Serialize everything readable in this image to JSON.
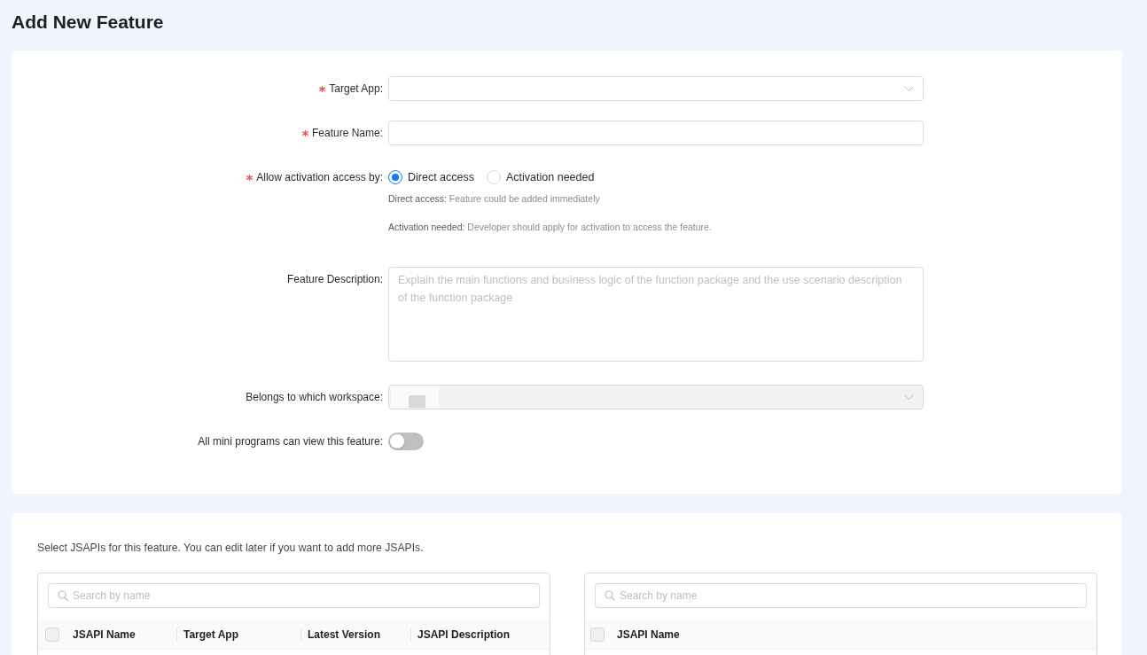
{
  "page": {
    "title": "Add New Feature"
  },
  "form": {
    "fields": [
      {
        "kind": "select",
        "label": "Target App:",
        "required": true,
        "disabled": false
      },
      {
        "kind": "input",
        "label": "Feature Name:",
        "required": true,
        "disabled": false
      },
      {
        "kind": "radio",
        "label": "Allow activation access by:",
        "required": true,
        "disabled": false,
        "options": [
          {
            "label": "Direct access",
            "selected": true
          },
          {
            "label": "Activation needed",
            "selected": false
          }
        ],
        "hints": [
          {
            "term": "Direct access:",
            "text": "Feature could be added immediately"
          },
          {
            "term": "Activation needed:",
            "text": "Developer should apply for activation to access the feature."
          }
        ]
      },
      {
        "kind": "textarea",
        "label": "Feature Description:",
        "required": false,
        "disabled": false,
        "placeholder": "Explain the main functions and business logic of the function package and the use scenario description of the function package"
      },
      {
        "kind": "select",
        "label": "Belongs to which workspace:",
        "required": false,
        "disabled": true,
        "masked_value": true
      },
      {
        "kind": "switch",
        "label": "All mini programs can view this feature:",
        "required": false,
        "disabled": false,
        "on": false
      }
    ]
  },
  "jsapi_section": {
    "instruction": "Select JSAPIs for this feature. You can edit later if you want to add more JSAPIs.",
    "panels": [
      {
        "search": {
          "placeholder": "Search by name"
        },
        "header_checkbox": {
          "checked": false,
          "disabled": true
        },
        "columns": [
          "JSAPI Name",
          "Target App",
          "Latest Version",
          "JSAPI Description"
        ]
      },
      {
        "search": {
          "placeholder": "Search by name"
        },
        "header_checkbox": {
          "checked": false,
          "disabled": true
        },
        "columns": [
          "JSAPI Name"
        ]
      }
    ]
  }
}
